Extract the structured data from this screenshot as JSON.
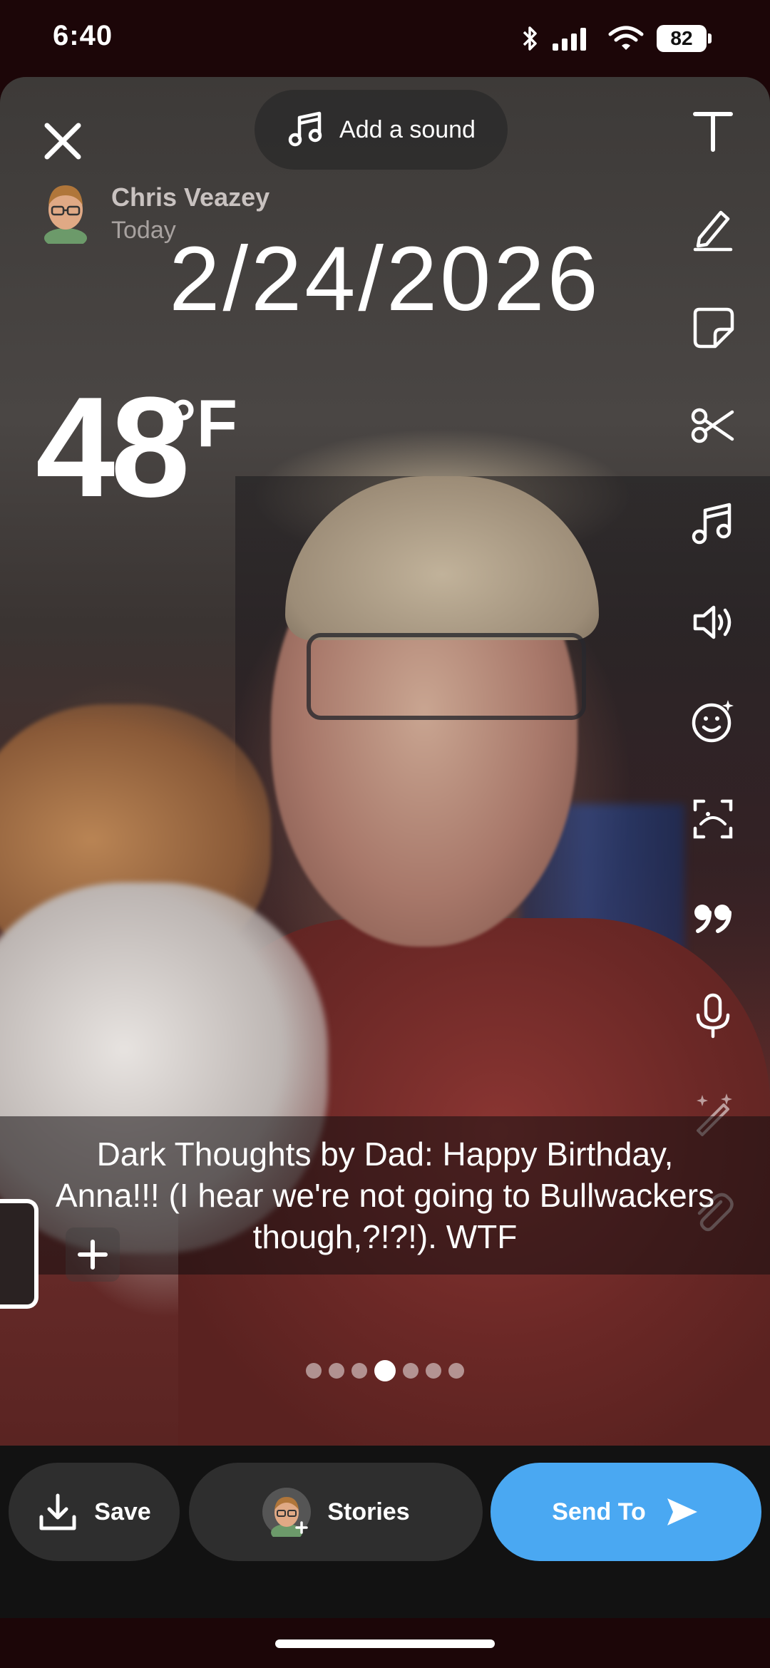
{
  "status_bar": {
    "time": "6:40",
    "battery": "82",
    "icons": [
      "bluetooth-icon",
      "cellular-signal-icon",
      "wifi-icon",
      "battery-icon"
    ]
  },
  "top": {
    "close_icon": "close-icon",
    "add_sound_label": "Add a sound"
  },
  "user": {
    "name": "Chris Veazey",
    "subtitle": "Today"
  },
  "stickers": {
    "date": "2/24/2026",
    "temperature": "48",
    "temperature_unit": "°F"
  },
  "toolbar": {
    "tools": [
      "text-icon",
      "pencil-icon",
      "sticker-icon",
      "scissors-icon",
      "music-icon",
      "sound-icon",
      "lens-icon",
      "scan-icon",
      "quote-icon",
      "microphone-icon",
      "magic-wand-icon",
      "paperclip-icon"
    ]
  },
  "caption": {
    "text": "Dark Thoughts by Dad: Happy Birthday, Anna!!! (I hear we're not going to Bullwackers though,?!?!). WTF"
  },
  "pagination": {
    "total": 7,
    "active_index": 3
  },
  "bottom": {
    "save_label": "Save",
    "stories_label": "Stories",
    "send_label": "Send To"
  },
  "colors": {
    "accent": "#4aa8f2",
    "status_bg": "#1c0608"
  }
}
